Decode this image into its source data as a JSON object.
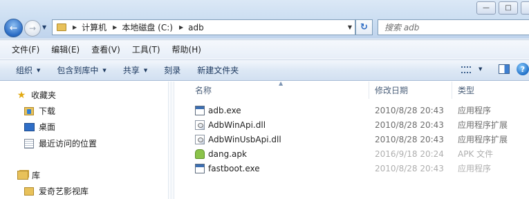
{
  "window": {
    "caption_buttons": [
      "minimize-icon",
      "maximize-icon",
      "close-icon"
    ]
  },
  "address_bar": {
    "breadcrumbs": [
      "计算机",
      "本地磁盘 (C:)",
      "adb"
    ]
  },
  "search": {
    "placeholder": "搜索 adb"
  },
  "menu": {
    "items": [
      "文件(F)",
      "编辑(E)",
      "查看(V)",
      "工具(T)",
      "帮助(H)"
    ]
  },
  "toolbar": {
    "organize": "组织",
    "include_in_library": "包含到库中",
    "share": "共享",
    "burn": "刻录",
    "new_folder": "新建文件夹"
  },
  "nav_pane": {
    "favorites": {
      "label": "收藏夹",
      "items": [
        "下载",
        "桌面",
        "最近访问的位置"
      ]
    },
    "libraries": {
      "label": "库",
      "items": [
        "爱奇艺影视库"
      ]
    }
  },
  "file_list": {
    "columns": {
      "name": "名称",
      "date": "修改日期",
      "type": "类型"
    },
    "rows": [
      {
        "name": "adb.exe",
        "date": "2010/8/28 20:43",
        "type": "应用程序",
        "icon": "exe-icon"
      },
      {
        "name": "AdbWinApi.dll",
        "date": "2010/8/28 20:43",
        "type": "应用程序扩展",
        "icon": "dll-icon"
      },
      {
        "name": "AdbWinUsbApi.dll",
        "date": "2010/8/28 20:43",
        "type": "应用程序扩展",
        "icon": "dll-icon"
      },
      {
        "name": "dang.apk",
        "date": "2016/9/18 20:24",
        "type": "APK 文件",
        "icon": "apk-icon"
      },
      {
        "name": "fastboot.exe",
        "date": "2010/8/28 20:43",
        "type": "应用程序",
        "icon": "exe-icon"
      }
    ]
  }
}
